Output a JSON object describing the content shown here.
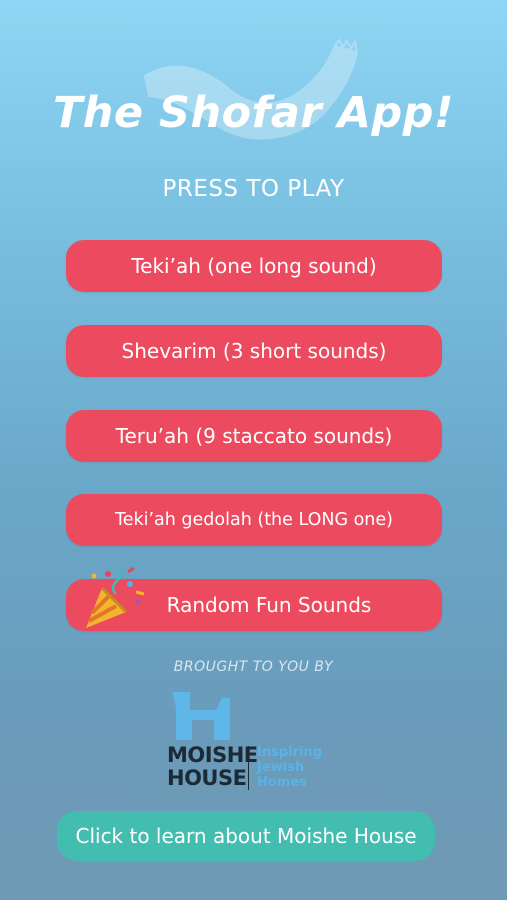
{
  "app": {
    "title": "The Shofar App!",
    "subtitle": "PRESS TO PLAY"
  },
  "buttons": [
    {
      "label": "Teki’ah (one long sound)"
    },
    {
      "label": "Shevarim (3 short sounds)"
    },
    {
      "label": "Teru’ah (9 staccato sounds)"
    },
    {
      "label": "Teki’ah gedolah (the LONG one)"
    },
    {
      "label": "Random Fun Sounds",
      "icon": "party-popper-icon"
    }
  ],
  "sponsor": {
    "brought_by": "BROUGHT TO YOU BY",
    "name_line1": "MOISHE",
    "name_line2": "HOUSE",
    "tagline": [
      "Inspiring",
      "Jewish",
      "Homes"
    ],
    "learn_label": "Click to learn about Moishe House"
  },
  "colors": {
    "button": "#ec4a5e",
    "learn_button": "#44bdb1",
    "tagline": "#59b4e6",
    "logo_icon": "#5fb6e8"
  }
}
